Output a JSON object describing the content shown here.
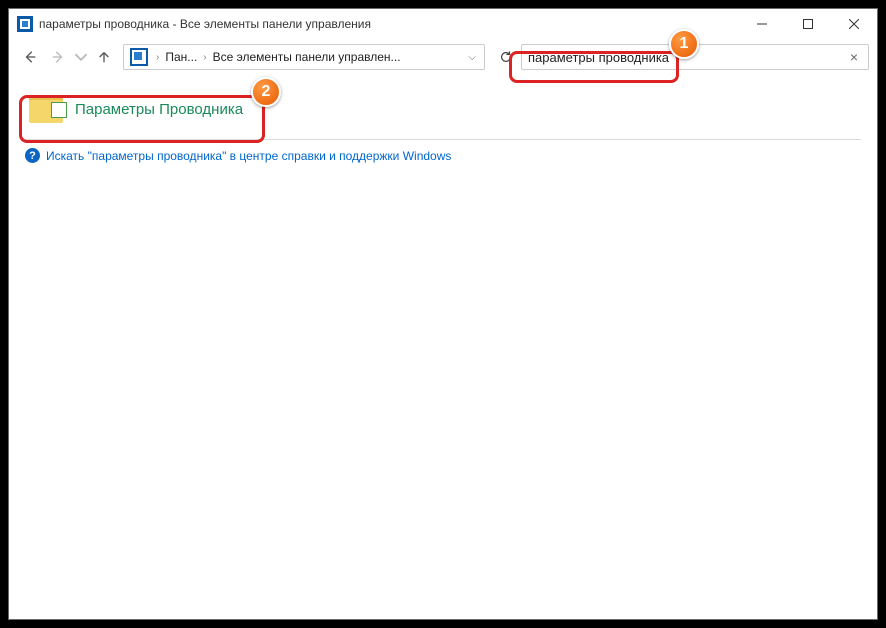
{
  "window": {
    "title": "параметры проводника - Все элементы панели управления"
  },
  "nav": {
    "crumb1": "Пан...",
    "crumb2": "Все элементы панели управлен..."
  },
  "search": {
    "value": "параметры проводника"
  },
  "result": {
    "label": "Параметры Проводника"
  },
  "help": {
    "text": "Искать \"параметры проводника\" в центре справки и поддержки Windows"
  },
  "annotations": {
    "badge1": "1",
    "badge2": "2"
  }
}
